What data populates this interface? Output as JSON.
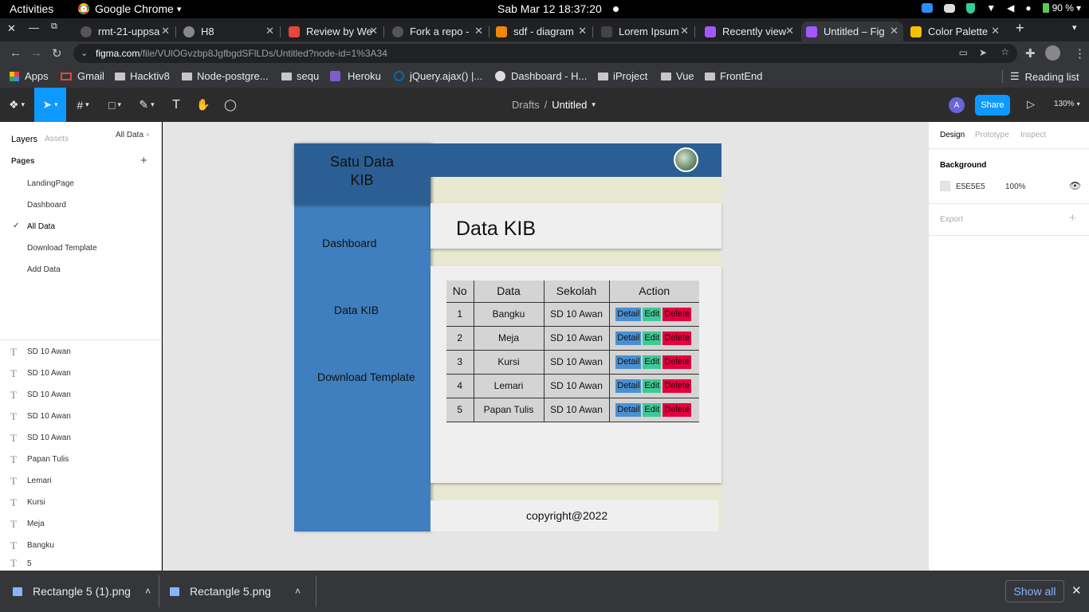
{
  "gnome": {
    "activities": "Activities",
    "app_name": "Google Chrome",
    "app_caret": "▾",
    "clock": "Sab Mar 12  18:37:20",
    "battery": "90 %"
  },
  "tabs": [
    {
      "label": "rmt-21-uppsa",
      "icon": "github-icon",
      "color": "#202124"
    },
    {
      "label": "H8",
      "icon": "globe-icon",
      "color": "#202124"
    },
    {
      "label": "Review by We",
      "icon": "review-icon",
      "color": "#e8453c"
    },
    {
      "label": "Fork a repo -",
      "icon": "github-icon",
      "color": "#202124"
    },
    {
      "label": "sdf - diagram",
      "icon": "diagram-icon",
      "color": "#f08705"
    },
    {
      "label": "Lorem Ipsum",
      "icon": "lorem-icon",
      "color": "#202124"
    },
    {
      "label": "Recently view",
      "icon": "figma-icon",
      "color": "#a259ff"
    },
    {
      "label": "Untitled – Fig",
      "icon": "figma-icon",
      "color": "#a259ff"
    },
    {
      "label": "Color Palette",
      "icon": "palette-icon",
      "color": "#f5c000"
    }
  ],
  "address": {
    "host": "figma.com",
    "path": "/file/VUlOGvzbp8JgfbgdSFlLDs/Untitled?node-id=1%3A34"
  },
  "bookmarks": [
    {
      "label": "Apps"
    },
    {
      "label": "Gmail"
    },
    {
      "label": "Hacktiv8"
    },
    {
      "label": "Node-postgre..."
    },
    {
      "label": "sequ"
    },
    {
      "label": "Heroku"
    },
    {
      "label": "jQuery.ajax() |..."
    },
    {
      "label": "Dashboard - H..."
    },
    {
      "label": "iProject"
    },
    {
      "label": "Vue"
    },
    {
      "label": "FrontEnd"
    }
  ],
  "reading_list": "Reading list",
  "figma": {
    "crumb_parent": "Drafts",
    "crumb_sep": "/",
    "file_name": "Untitled",
    "avatar": "A",
    "share": "Share",
    "zoom": "130%"
  },
  "left_panel": {
    "tab_layers": "Layers",
    "tab_assets": "Assets",
    "page_select": "All Data",
    "pages_title": "Pages",
    "add_page": "+",
    "pages": [
      "LandingPage",
      "Dashboard",
      "All Data",
      "Download Template",
      "Add Data"
    ],
    "active_page": "All Data",
    "layers": [
      "SD 10 Awan",
      "SD 10 Awan",
      "SD 10 Awan",
      "SD 10 Awan",
      "SD 10 Awan",
      "Papan Tulis",
      "Lemari",
      "Kursi",
      "Meja",
      "Bangku",
      "5"
    ]
  },
  "right_panel": {
    "tab_design": "Design",
    "tab_prototype": "Prototype",
    "tab_inspect": "Inspect",
    "background_title": "Background",
    "bg_hex": "E5E5E5",
    "bg_opacity": "100%",
    "export_title": "Export",
    "export_add": "+"
  },
  "design": {
    "brand": "Satu Data KIB",
    "nav": [
      "Dashboard",
      "Data KIB",
      "Download Template"
    ],
    "page_heading": "Data KIB",
    "table_headers": [
      "No",
      "Data",
      "Sekolah",
      "Action"
    ],
    "rows": [
      {
        "no": "1",
        "data": "Bangku",
        "sekolah": "SD 10 Awan"
      },
      {
        "no": "2",
        "data": "Meja",
        "sekolah": "SD 10 Awan"
      },
      {
        "no": "3",
        "data": "Kursi",
        "sekolah": "SD 10 Awan"
      },
      {
        "no": "4",
        "data": "Lemari",
        "sekolah": "SD 10 Awan"
      },
      {
        "no": "5",
        "data": "Papan Tulis",
        "sekolah": "SD 10 Awan"
      }
    ],
    "btn_detail": "Detail",
    "btn_edit": "Edit",
    "btn_delete": "Delete",
    "footer": "copyright@2022",
    "colors": {
      "sidebar": "#3f7fbf",
      "header": "#2b5f93",
      "detail": "#4a90d0",
      "edit": "#3ec995",
      "delete": "#e4003d"
    }
  },
  "help": "?",
  "downloads": [
    {
      "label": "Rectangle 5 (1).png"
    },
    {
      "label": "Rectangle 5.png"
    }
  ],
  "show_all": "Show all"
}
